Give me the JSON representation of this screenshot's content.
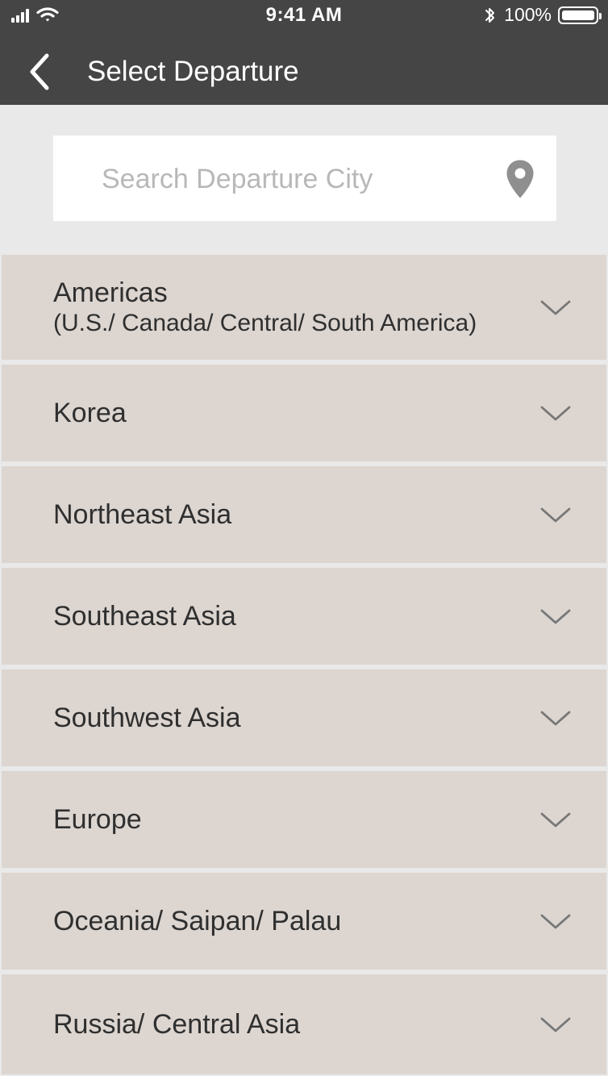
{
  "status_bar": {
    "time": "9:41 AM",
    "battery_text": "100%",
    "icons": [
      "signal-icon",
      "wifi-icon",
      "bluetooth-icon",
      "battery-icon"
    ]
  },
  "nav": {
    "back_icon": "chevron-left-icon",
    "title": "Select Departure"
  },
  "search": {
    "placeholder": "Search Departure City",
    "value": "",
    "location_icon": "map-pin-icon"
  },
  "regions": [
    {
      "label": "Americas",
      "sublabel": "(U.S./ Canada/ Central/ South America)",
      "expand_icon": "chevron-down-icon"
    },
    {
      "label": "Korea",
      "expand_icon": "chevron-down-icon"
    },
    {
      "label": "Northeast Asia",
      "expand_icon": "chevron-down-icon"
    },
    {
      "label": "Southeast Asia",
      "expand_icon": "chevron-down-icon"
    },
    {
      "label": "Southwest Asia",
      "expand_icon": "chevron-down-icon"
    },
    {
      "label": "Europe",
      "expand_icon": "chevron-down-icon"
    },
    {
      "label": "Oceania/ Saipan/ Palau",
      "expand_icon": "chevron-down-icon"
    },
    {
      "label": "Russia/ Central Asia",
      "expand_icon": "chevron-down-icon"
    }
  ],
  "colors": {
    "header_background": "#454545",
    "search_area_background": "#e9e9e9",
    "region_background": "#dcd5d0",
    "text": "#2f2f2f",
    "placeholder": "#b8b8b8",
    "icon": "#8f8f8f"
  }
}
